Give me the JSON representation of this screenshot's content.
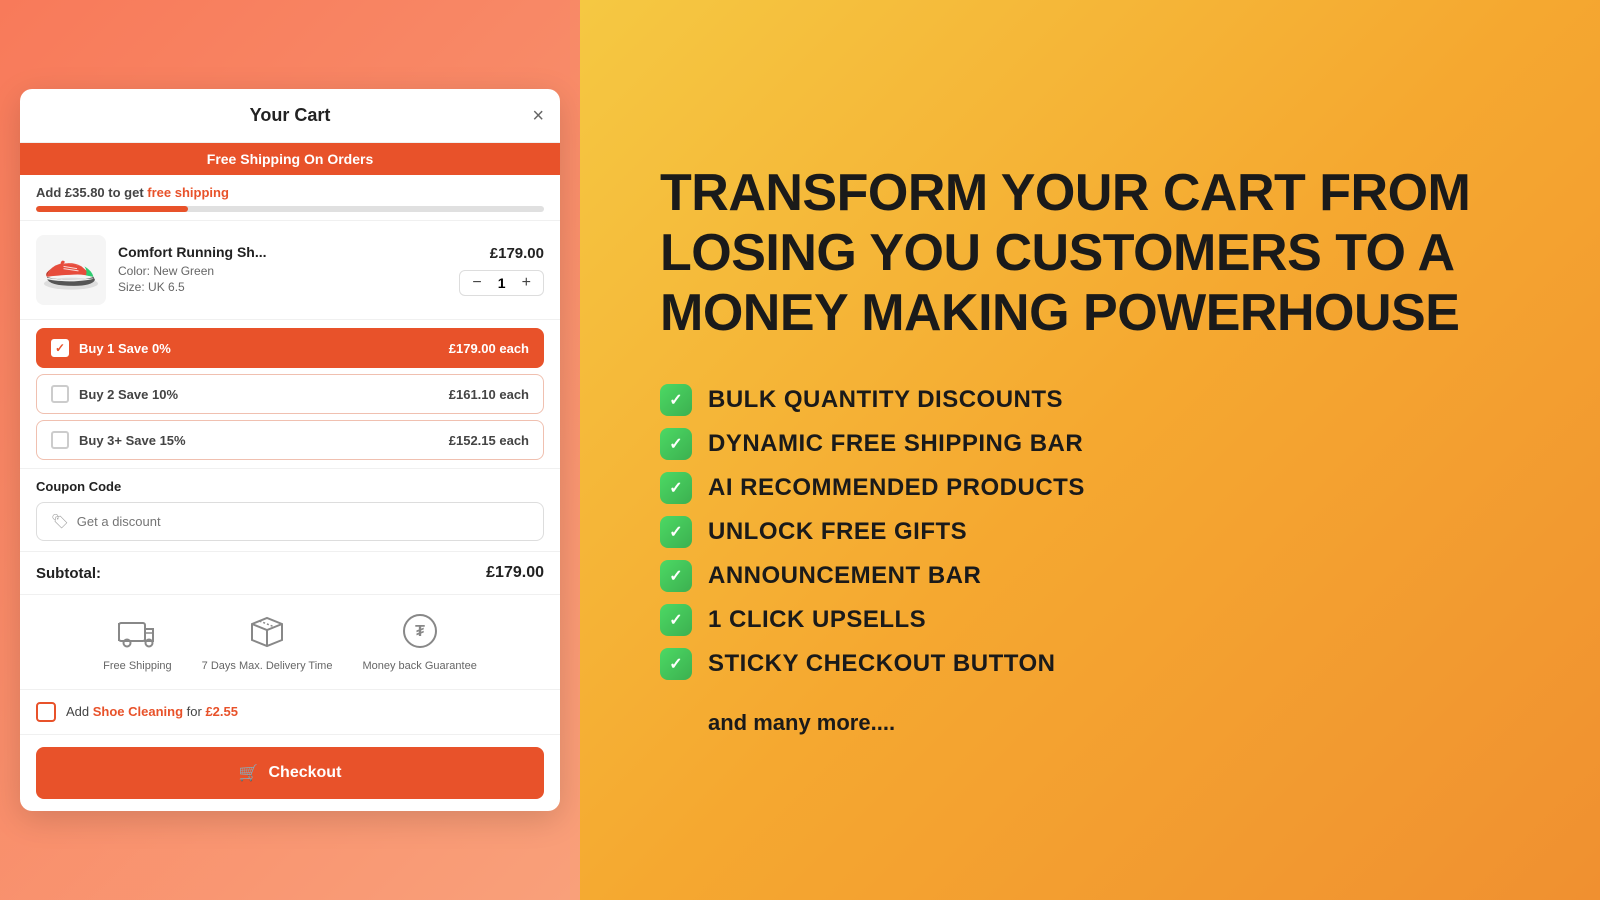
{
  "cart": {
    "title": "Your Cart",
    "close_label": "×",
    "banner": "Free Shipping On Orders",
    "shipping_progress_text": "Add ",
    "shipping_amount": "£35.80",
    "shipping_suffix": " to get ",
    "shipping_free_label": "free shipping",
    "progress_percent": 30,
    "item": {
      "name": "Comfort Running Sh...",
      "price": "£179.00",
      "color_label": "Color:",
      "color_value": "New Green",
      "size_label": "Size:",
      "size_value": "UK 6.5",
      "quantity": "1"
    },
    "discounts": [
      {
        "label": "Buy 1 Save 0%",
        "price": "£179.00 each",
        "selected": true
      },
      {
        "label": "Buy 2 Save 10%",
        "price": "£161.10 each",
        "selected": false
      },
      {
        "label": "Buy 3+ Save 15%",
        "price": "£152.15 each",
        "selected": false
      }
    ],
    "coupon": {
      "label": "Coupon Code",
      "placeholder": "Get a discount"
    },
    "subtotal_label": "Subtotal:",
    "subtotal_value": "£179.00",
    "badges": [
      {
        "icon": "truck",
        "text": "Free Shipping"
      },
      {
        "icon": "box",
        "text": "7 Days Max. Delivery Time"
      },
      {
        "icon": "shield",
        "text": "Money back Guarantee"
      }
    ],
    "addon_prefix": "Add ",
    "addon_name": "Shoe Cleaning",
    "addon_mid": " for ",
    "addon_price": "£2.55",
    "checkout_label": "Checkout"
  },
  "right": {
    "headline_line1": "TRANSFORM YOUR CART FROM",
    "headline_line2": "LOSING YOU CUSTOMERS TO A",
    "headline_line3": "MONEY MAKING POWERHOUSE",
    "features": [
      "BULK QUANTITY DISCOUNTS",
      "DYNAMIC FREE SHIPPING BAR",
      "AI RECOMMENDED PRODUCTS",
      "UNLOCK FREE GIFTS",
      "ANNOUNCEMENT BAR",
      "1 CLICK UPSELLS",
      "STICKY CHECKOUT BUTTON"
    ],
    "and_more": "and many more...."
  }
}
